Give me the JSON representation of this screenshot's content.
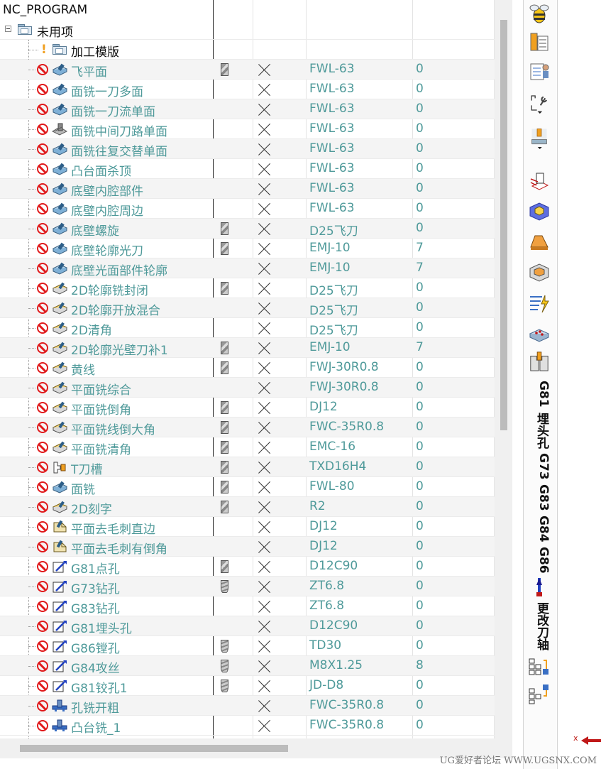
{
  "tree": {
    "root_label": "NC_PROGRAM",
    "group_label": "未用项",
    "template_label": "加工模版",
    "operations": [
      {
        "name": "飞平面",
        "icon": "face-mill-icon",
        "toolpath": true,
        "tool": "FWL-63",
        "num": "0"
      },
      {
        "name": "面铣一刀多面",
        "icon": "face-mill-icon",
        "toolpath": false,
        "tool": "FWL-63",
        "num": "0"
      },
      {
        "name": "面铣一刀流单面",
        "icon": "face-mill-icon",
        "toolpath": false,
        "tool": "FWL-63",
        "num": "0"
      },
      {
        "name": "面铣中间刀路单面",
        "icon": "face-mill-mid-icon",
        "toolpath": false,
        "tool": "FWL-63",
        "num": "0"
      },
      {
        "name": "面铣往复交替单面",
        "icon": "face-mill-icon",
        "toolpath": false,
        "tool": "FWL-63",
        "num": "0"
      },
      {
        "name": "凸台面杀顶",
        "icon": "face-mill-icon",
        "toolpath": false,
        "tool": "FWL-63",
        "num": "0"
      },
      {
        "name": "底壁内腔部件",
        "icon": "face-mill-icon",
        "toolpath": false,
        "tool": "FWL-63",
        "num": "0"
      },
      {
        "name": "底壁内腔周边",
        "icon": "face-mill-icon",
        "toolpath": false,
        "tool": "FWL-63",
        "num": "0"
      },
      {
        "name": "底壁螺旋",
        "icon": "face-mill-icon",
        "toolpath": true,
        "tool": "D25飞刀",
        "num": "0"
      },
      {
        "name": "底壁轮廓光刀",
        "icon": "face-mill-icon",
        "toolpath": true,
        "tool": "EMJ-10",
        "num": "7"
      },
      {
        "name": "底壁光面部件轮廓",
        "icon": "face-mill-icon",
        "toolpath": false,
        "tool": "EMJ-10",
        "num": "7"
      },
      {
        "name": "2D轮廓铣封闭",
        "icon": "contour-icon",
        "toolpath": true,
        "tool": "D25飞刀",
        "num": "0"
      },
      {
        "name": "2D轮廓开放混合",
        "icon": "contour-icon",
        "toolpath": false,
        "tool": "D25飞刀",
        "num": "0"
      },
      {
        "name": "2D清角",
        "icon": "contour-icon",
        "toolpath": false,
        "tool": "D25飞刀",
        "num": "0"
      },
      {
        "name": "2D轮廓光壁刀补1",
        "icon": "contour-icon",
        "toolpath": true,
        "tool": "EMJ-10",
        "num": "7"
      },
      {
        "name": "黄线",
        "icon": "contour-icon",
        "toolpath": true,
        "tool": "FWJ-30R0.8",
        "num": "0"
      },
      {
        "name": "平面铣综合",
        "icon": "contour-icon",
        "toolpath": false,
        "tool": "FWJ-30R0.8",
        "num": "0"
      },
      {
        "name": "平面铣倒角",
        "icon": "contour-icon",
        "toolpath": true,
        "tool": "DJ12",
        "num": "0"
      },
      {
        "name": "平面铣线倒大角",
        "icon": "contour-icon",
        "toolpath": true,
        "tool": "FWC-35R0.8",
        "num": "0"
      },
      {
        "name": "平面铣清角",
        "icon": "contour-icon",
        "toolpath": true,
        "tool": "EMC-16",
        "num": "0"
      },
      {
        "name": "T刀槽",
        "icon": "t-slot-icon",
        "toolpath": true,
        "tool": "TXD16H4",
        "num": "0"
      },
      {
        "name": "面铣",
        "icon": "face-mill-icon",
        "toolpath": true,
        "tool": "FWL-80",
        "num": "0"
      },
      {
        "name": "2D刻字",
        "icon": "contour-icon",
        "toolpath": true,
        "tool": "R2",
        "num": "0"
      },
      {
        "name": "平面去毛刺直边",
        "icon": "deburr-icon",
        "toolpath": false,
        "tool": "DJ12",
        "num": "0"
      },
      {
        "name": "平面去毛刺有倒角",
        "icon": "deburr-icon",
        "toolpath": false,
        "tool": "DJ12",
        "num": "0"
      },
      {
        "name": "G81点孔",
        "icon": "drill-op-icon",
        "toolpath": true,
        "tool": "D12C90",
        "num": "0"
      },
      {
        "name": "G73钻孔",
        "icon": "drill-op-icon",
        "toolpath": "drill",
        "tool": "ZT6.8",
        "num": "0"
      },
      {
        "name": "G83钻孔",
        "icon": "drill-op-icon",
        "toolpath": false,
        "tool": "ZT6.8",
        "num": "0"
      },
      {
        "name": "G81埋头孔",
        "icon": "drill-op-icon",
        "toolpath": false,
        "tool": "D12C90",
        "num": "0"
      },
      {
        "name": "G86镗孔",
        "icon": "drill-op-icon",
        "toolpath": "drill",
        "tool": "TD30",
        "num": "0"
      },
      {
        "name": "G84攻丝",
        "icon": "drill-op-icon",
        "toolpath": "drill",
        "tool": "M8X1.25",
        "num": "8"
      },
      {
        "name": "G81铰孔1",
        "icon": "drill-op-icon",
        "toolpath": "drill",
        "tool": "JD-D8",
        "num": "0"
      },
      {
        "name": "孔铣开粗",
        "icon": "hole-mill-icon",
        "toolpath": false,
        "tool": "FWC-35R0.8",
        "num": "0"
      },
      {
        "name": "凸台铣_1",
        "icon": "hole-mill-icon",
        "toolpath": false,
        "tool": "FWC-35R0.8",
        "num": "0"
      }
    ]
  },
  "right_toolbar": {
    "texts": [
      "G81",
      "埋头孔",
      "G73",
      "G83",
      "G84",
      "G86",
      "更改刀轴"
    ]
  },
  "footer": {
    "x_label": "x",
    "watermark": "UG爱好者论坛  WWW.UGSNX.COM"
  },
  "colors": {
    "op_text": "#4f9a9a",
    "no_icon": "#e0191b",
    "accent_orange": "#f0a020"
  }
}
